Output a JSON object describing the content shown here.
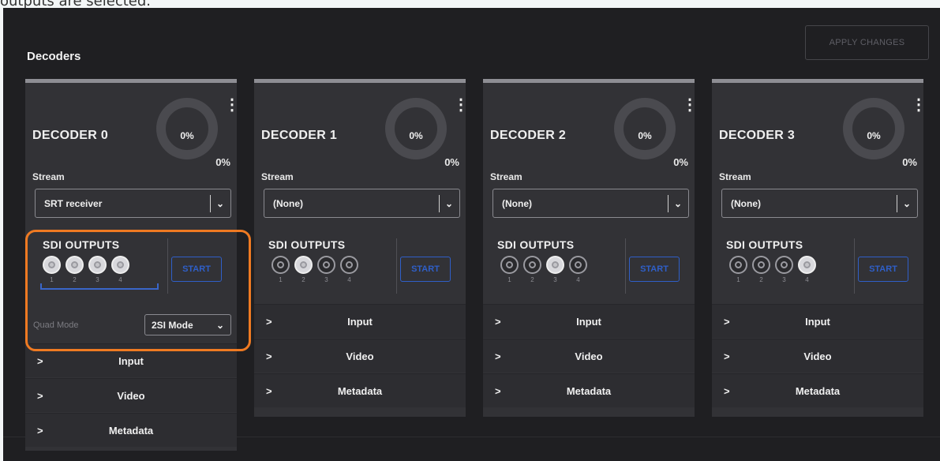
{
  "caption": "outputs are selected.",
  "header": {
    "title": "Decoders",
    "apply_label": "APPLY CHANGES"
  },
  "common": {
    "stream_label": "Stream",
    "sdi_title": "SDI OUTPUTS",
    "start_label": "START",
    "port_numbers": [
      "1",
      "2",
      "3",
      "4"
    ],
    "chevron_right": ">",
    "chevron_down": "⌄",
    "kebab": "⋮"
  },
  "colors": {
    "accent_blue": "#2f5fc8",
    "highlight_orange": "#ef7a22"
  },
  "decoders": [
    {
      "name": "DECODER 0",
      "ring_value": "0%",
      "side_value": "0%",
      "stream_value": "SRT receiver",
      "ports_on": [
        1,
        2,
        3,
        4
      ],
      "quad_label": "Quad Mode",
      "quad_value": "2SI Mode",
      "sections": [
        "Input",
        "Video",
        "Metadata"
      ]
    },
    {
      "name": "DECODER 1",
      "ring_value": "0%",
      "side_value": "0%",
      "stream_value": "(None)",
      "ports_on": [
        2
      ],
      "sections": [
        "Input",
        "Video",
        "Metadata"
      ]
    },
    {
      "name": "DECODER 2",
      "ring_value": "0%",
      "side_value": "0%",
      "stream_value": "(None)",
      "ports_on": [
        3
      ],
      "sections": [
        "Input",
        "Video",
        "Metadata"
      ]
    },
    {
      "name": "DECODER 3",
      "ring_value": "0%",
      "side_value": "0%",
      "stream_value": "(None)",
      "ports_on": [
        4
      ],
      "sections": [
        "Input",
        "Video",
        "Metadata"
      ]
    }
  ]
}
